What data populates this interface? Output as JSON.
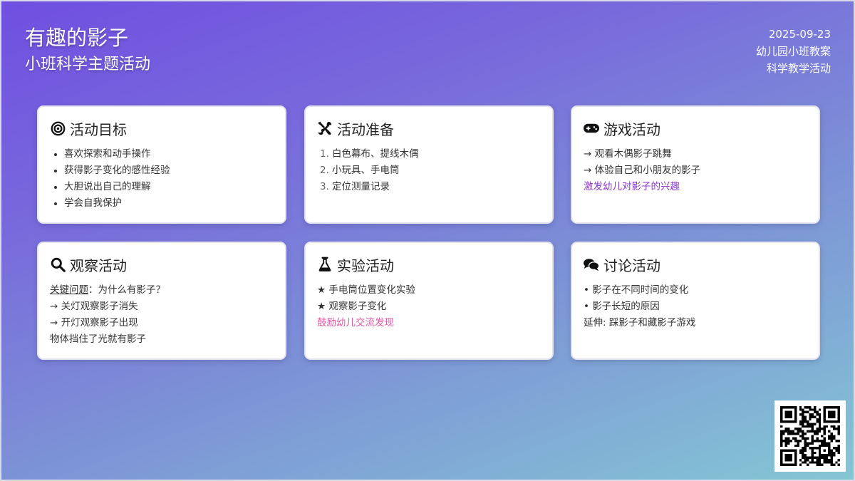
{
  "header": {
    "title": "有趣的影子",
    "subtitle": "小班科学主题活动",
    "date": "2025-09-23",
    "meta1": "幼儿园小班教案",
    "meta2": "科学教学活动"
  },
  "cards": {
    "goals": {
      "icon": "target-icon",
      "title": "活动目标",
      "items": [
        "喜欢探索和动手操作",
        "获得影子变化的感性经验",
        "大胆说出自己的理解",
        "学会自我保护"
      ]
    },
    "prep": {
      "icon": "tools-icon",
      "title": "活动准备",
      "items": [
        {
          "num": "1.",
          "text": "白色幕布、提线木偶"
        },
        {
          "num": "2.",
          "text": "小玩具、手电筒"
        },
        {
          "num": "3.",
          "text": "定位测量记录"
        }
      ]
    },
    "game": {
      "icon": "gamepad-icon",
      "title": "游戏活动",
      "line1": "→ 观看木偶影子跳舞",
      "line2": "→ 体验自己和小朋友的影子",
      "highlight": "激发幼儿对影子的兴趣"
    },
    "observe": {
      "icon": "search-icon",
      "title": "观察活动",
      "key_label": "关键问题",
      "key_question": "：为什么有影子？",
      "line1": "→ 关灯观察影子消失",
      "line2": "→ 开灯观察影子出现",
      "line3": "物体挡住了光就有影子"
    },
    "experiment": {
      "icon": "flask-icon",
      "title": "实验活动",
      "line1": "★ 手电筒位置变化实验",
      "line2": "★ 观察影子变化",
      "highlight": "鼓励幼儿交流发现"
    },
    "discuss": {
      "icon": "comments-icon",
      "title": "讨论活动",
      "line1": "• 影子在不同时间的变化",
      "line2": "• 影子长短的原因",
      "line3": "延伸: 踩影子和藏影子游戏"
    }
  },
  "colors": {
    "gradient_start": "#6f4fe0",
    "gradient_end": "#84c6d4",
    "highlight_purple": "#8a3ac8",
    "highlight_pink": "#e05aa0"
  },
  "qr_icon": "qr-code-icon"
}
